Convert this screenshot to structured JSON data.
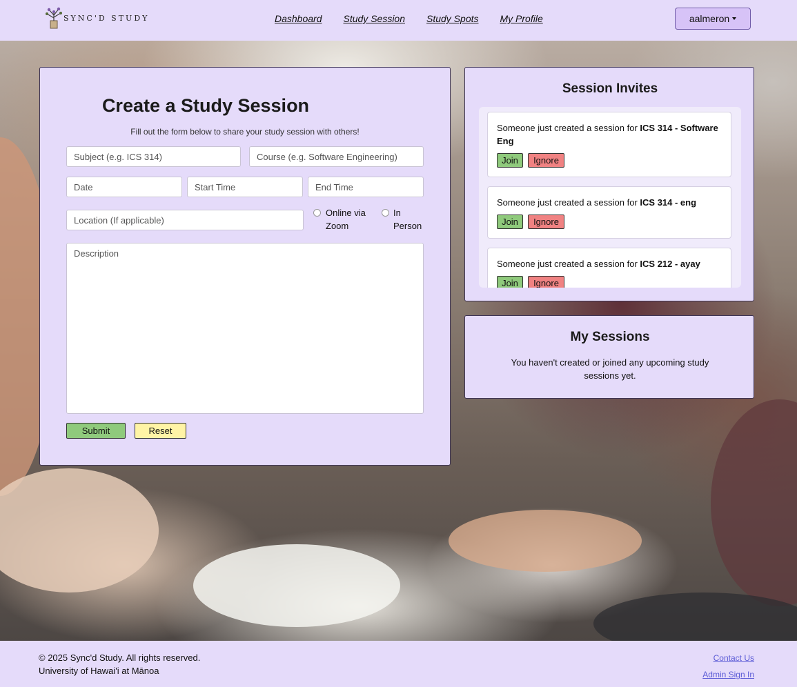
{
  "brand": {
    "logo_text": "SYNC'D STUDY"
  },
  "nav": {
    "links": [
      "Dashboard",
      "Study Session",
      "Study Spots",
      "My Profile"
    ],
    "user": "aalmeron"
  },
  "create": {
    "title": "Create a Study Session",
    "subtitle": "Fill out the form below to share your study session with others!",
    "subject_placeholder": "Subject (e.g. ICS 314)",
    "course_placeholder": "Course (e.g. Software Engineering)",
    "date_placeholder": "Date",
    "start_placeholder": "Start Time",
    "end_placeholder": "End Time",
    "location_placeholder": "Location (If applicable)",
    "radio_online": "Online via Zoom",
    "radio_online_l1": "Online via",
    "radio_online_l2": "Zoom",
    "radio_inperson_l1": "In",
    "radio_inperson_l2": "Person",
    "description_placeholder": "Description",
    "submit_label": "Submit",
    "reset_label": "Reset"
  },
  "invites": {
    "title": "Session Invites",
    "message_prefix": "Someone just created a session for",
    "items": [
      {
        "course": "ICS 314 - Software Eng"
      },
      {
        "course": "ICS 314 - eng"
      },
      {
        "course": "ICS 212 - ayay"
      }
    ],
    "join_label": "Join",
    "ignore_label": "Ignore"
  },
  "sessions": {
    "title": "My Sessions",
    "empty_text": "You haven't created or joined any upcoming study sessions yet."
  },
  "footer": {
    "copyright": "© 2025 Sync'd Study. All rights reserved.",
    "university": "University of Hawai'i at Mānoa",
    "contact_label": "Contact Us",
    "admin_label": "Admin Sign In"
  },
  "colors": {
    "panel": "#e5dbfa",
    "user_button": "#d7c3f7",
    "join": "#8fca7c",
    "ignore": "#f08282",
    "submit": "#8fca7c",
    "reset": "#fff4a6",
    "link": "#5b5bd6"
  }
}
